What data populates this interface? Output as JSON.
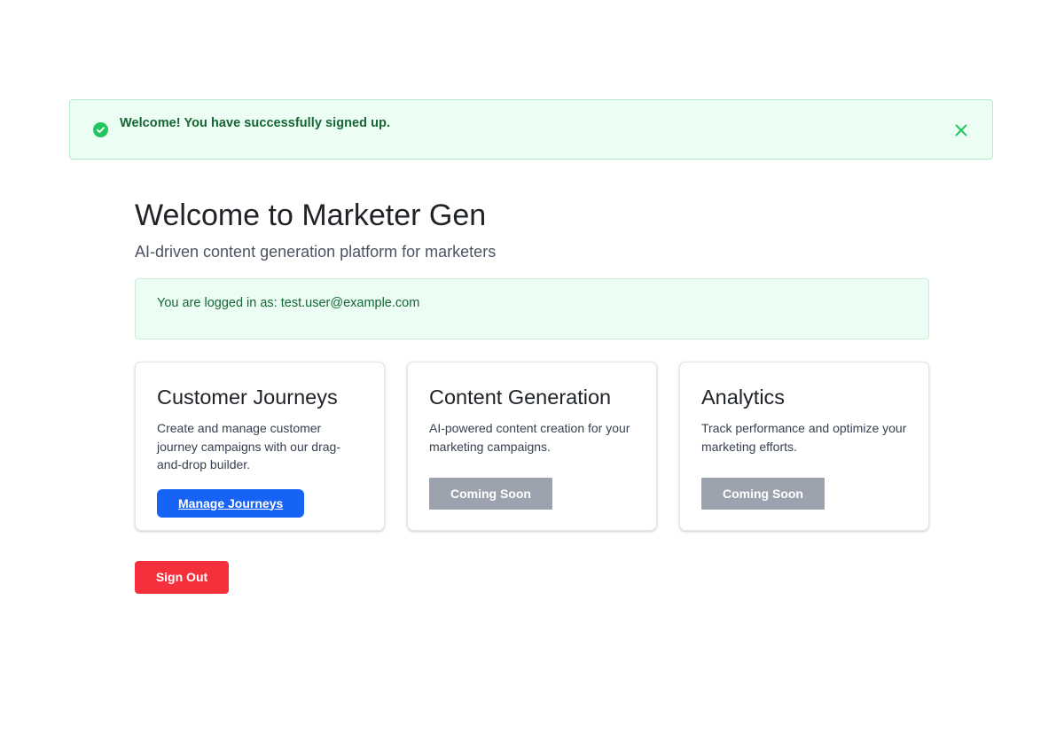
{
  "alert": {
    "message": "Welcome! You have successfully signed up.",
    "icon": "check-circle-icon",
    "close_icon": "close-icon",
    "color": "#22c55e"
  },
  "header": {
    "title": "Welcome to Marketer Gen",
    "subtitle": "AI-driven content generation platform for marketers"
  },
  "session": {
    "logged_in_text": "You are logged in as: test.user@example.com"
  },
  "cards": [
    {
      "title": "Customer Journeys",
      "description": "Create and manage customer journey campaigns with our drag-and-drop builder.",
      "button_label": "Manage Journeys"
    },
    {
      "title": "Content Generation",
      "description": "AI-powered content creation for your marketing campaigns.",
      "button_label": "Coming Soon"
    },
    {
      "title": "Analytics",
      "description": "Track performance and optimize your marketing efforts.",
      "button_label": "Coming Soon"
    }
  ],
  "actions": {
    "sign_out_label": "Sign Out"
  },
  "colors": {
    "primary": "#1763f6",
    "danger": "#f5303d",
    "success_bg": "#ecfdf3",
    "success_text": "#166534",
    "disabled": "#9ca3af"
  }
}
